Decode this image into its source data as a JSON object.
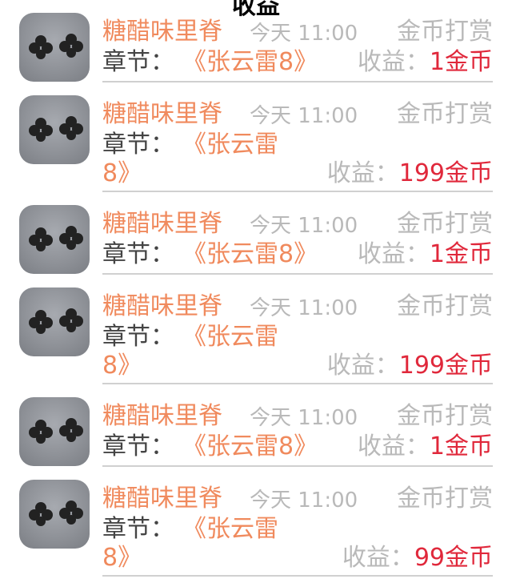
{
  "page": {
    "title": "收益"
  },
  "rows": [
    {
      "author": "糖醋味里脊",
      "time": "今天 11:00",
      "tip": "金币打赏",
      "chapter_label": "章节：",
      "chapter_name": "《张云雷8》",
      "chapter_cont": "",
      "income_label": "收益：",
      "income_value": "1金币"
    },
    {
      "author": "糖醋味里脊",
      "time": "今天 11:00",
      "tip": "金币打赏",
      "chapter_label": "章节：",
      "chapter_name": "《张云雷",
      "chapter_cont": "8》",
      "income_label": "收益：",
      "income_value": "199金币"
    },
    {
      "author": "糖醋味里脊",
      "time": "今天 11:00",
      "tip": "金币打赏",
      "chapter_label": "章节：",
      "chapter_name": "《张云雷8》",
      "chapter_cont": "",
      "income_label": "收益：",
      "income_value": "1金币"
    },
    {
      "author": "糖醋味里脊",
      "time": "今天 11:00",
      "tip": "金币打赏",
      "chapter_label": "章节：",
      "chapter_name": "《张云雷",
      "chapter_cont": "8》",
      "income_label": "收益：",
      "income_value": "199金币"
    },
    {
      "author": "糖醋味里脊",
      "time": "今天 11:00",
      "tip": "金币打赏",
      "chapter_label": "章节：",
      "chapter_name": "《张云雷8》",
      "chapter_cont": "",
      "income_label": "收益：",
      "income_value": "1金币"
    },
    {
      "author": "糖醋味里脊",
      "time": "今天 11:00",
      "tip": "金币打赏",
      "chapter_label": "章节：",
      "chapter_name": "《张云雷",
      "chapter_cont": "8》",
      "income_label": "收益：",
      "income_value": "99金币"
    }
  ],
  "colors": {
    "accent": "#f08a5d",
    "income_value": "#e0283b",
    "muted": "#b9b9b9",
    "divider": "#d0d0d0"
  },
  "icons": {
    "avatar": "clover-earring-photo"
  }
}
